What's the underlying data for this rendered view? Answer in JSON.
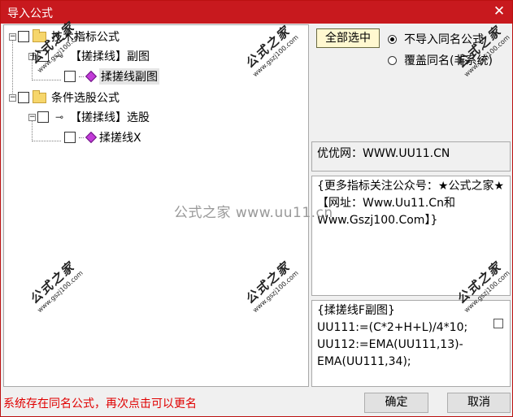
{
  "window": {
    "title": "导入公式",
    "close_glyph": "✕"
  },
  "tree": {
    "items": [
      {
        "label": "技术指标公式",
        "icon": "folder-icon"
      },
      {
        "label": "【搓揉线】副图",
        "icon": "key-icon"
      },
      {
        "label": "揉搓线副图",
        "icon": "formula-icon",
        "selected": true
      },
      {
        "label": "条件选股公式",
        "icon": "folder-icon"
      },
      {
        "label": "【搓揉线】选股",
        "icon": "key-icon"
      },
      {
        "label": "揉搓线X",
        "icon": "formula-icon"
      }
    ],
    "expand_glyph": "−"
  },
  "options": {
    "select_all_label": "全部选中",
    "radio_skip_label": "不导入同名公式",
    "radio_overwrite_label": "覆盖同名(非系统)",
    "selected_radio": "skip"
  },
  "panels": {
    "site": "优优网：WWW.UU11.CN",
    "more_info": "{更多指标关注公众号：★公式之家★【网址：Www.Uu11.Cn和Www.Gszj100.Com】}",
    "code_lines": [
      "{揉搓线F副图}",
      "UU111:=(C*2+H+L)/4*10;",
      "UU112:=EMA(UU111,13)-",
      "EMA(UU111,34);"
    ]
  },
  "status": {
    "message": "系统存在同名公式，再次点击可以更名",
    "color": "#e00000"
  },
  "buttons": {
    "ok_label": "确定",
    "cancel_label": "取消"
  },
  "watermark": {
    "big": "公式之家",
    "small": "www.gszj100.com",
    "center": "公式之家 www.uu11.cn"
  },
  "colors": {
    "titlebar": "#c8191e",
    "status_text": "#e00000"
  }
}
